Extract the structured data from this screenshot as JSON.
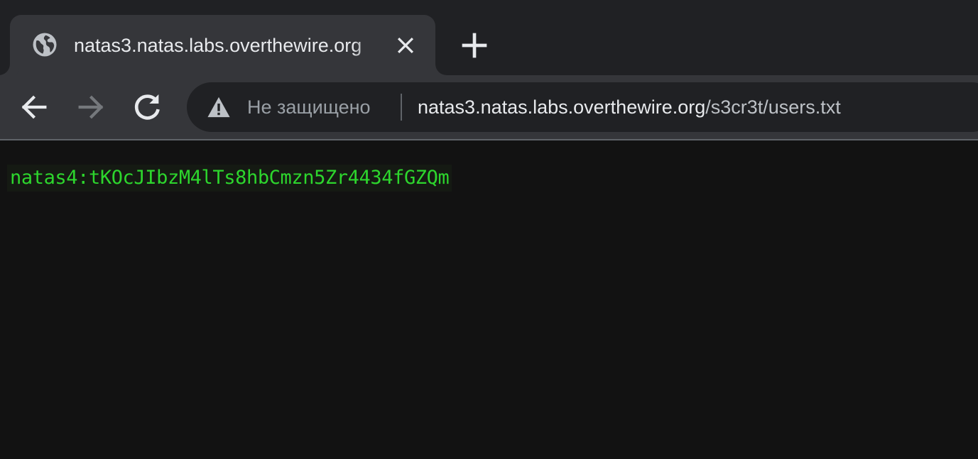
{
  "tab": {
    "title": "natas3.natas.labs.overthewire.org",
    "favicon": "globe-icon",
    "close": "close-icon"
  },
  "new_tab": {
    "icon": "plus-icon"
  },
  "toolbar": {
    "back_icon": "arrow-left-icon",
    "forward_icon": "arrow-right-icon",
    "reload_icon": "reload-icon"
  },
  "omnibox": {
    "security_icon": "warning-icon",
    "security_label": "Не защищено",
    "url_host": "natas3.natas.labs.overthewire.org",
    "url_path": "/s3cr3t/users.txt"
  },
  "content": {
    "text": "natas4:tKOcJIbzM4lTs8hbCmzn5Zr4434fGZQm"
  },
  "colors": {
    "tab_strip": "#202124",
    "toolbar": "#35363a",
    "page_background": "#121212",
    "text_green": "#2dd62d"
  }
}
